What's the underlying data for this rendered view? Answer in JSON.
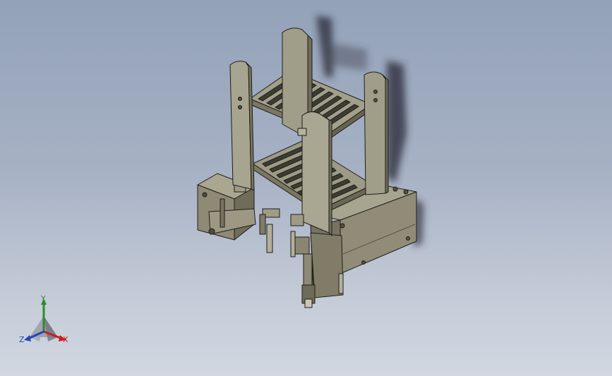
{
  "viewport": {
    "background_top": "#93a2b8",
    "background_bottom": "#d2d7e1"
  },
  "model": {
    "face_light": "#a9a691",
    "face_mid": "#8f8b76",
    "face_dark": "#6d6a59",
    "edge": "#1e1e1a",
    "shadow": "#222530"
  },
  "triad": {
    "x_label": "X",
    "y_label": "Y",
    "z_label": "Z",
    "x_color": "#c42020",
    "y_color": "#2d8a2d",
    "z_color": "#2545b8"
  }
}
